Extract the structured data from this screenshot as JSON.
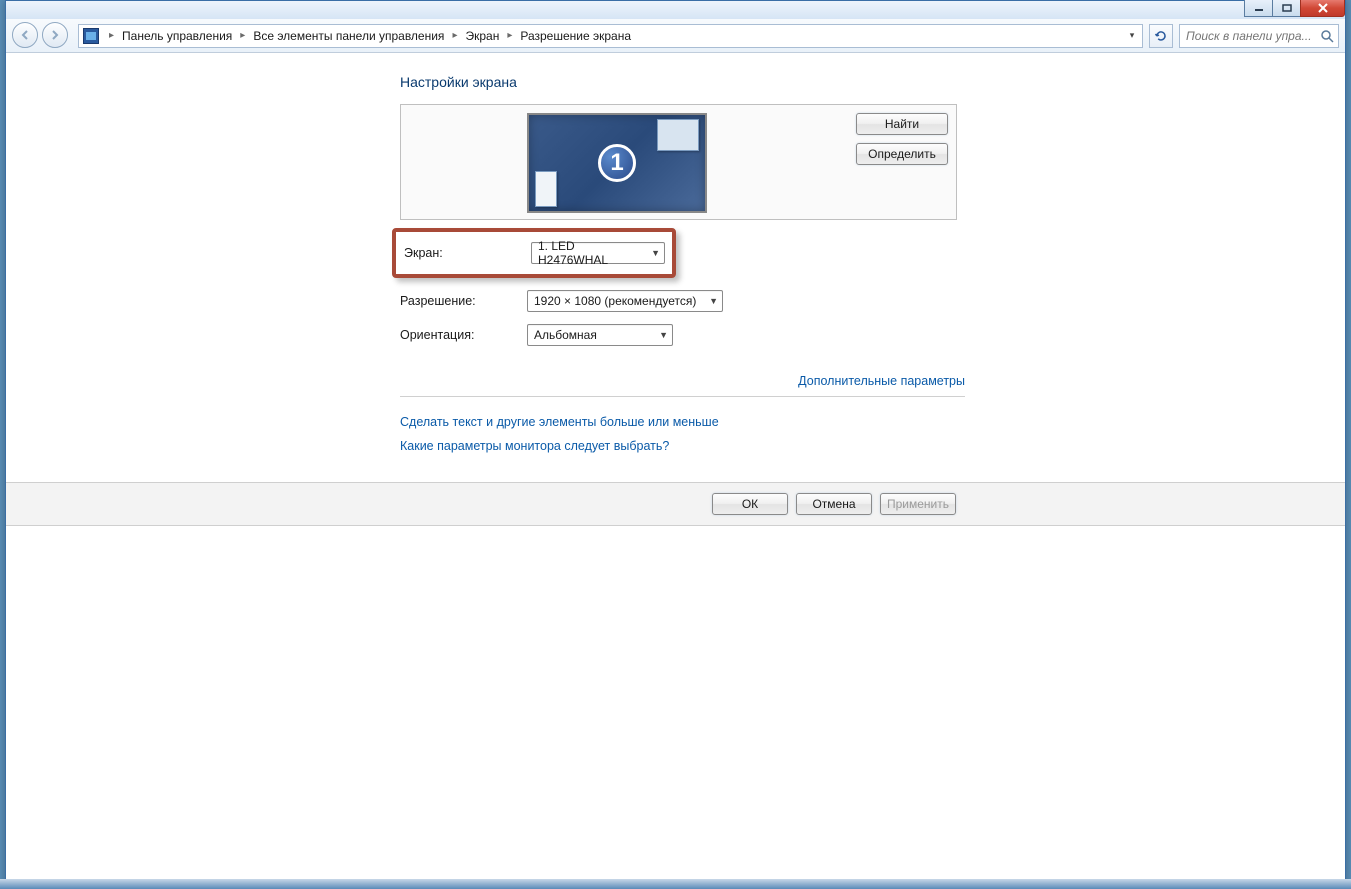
{
  "breadcrumb": {
    "items": [
      "Панель управления",
      "Все элементы панели управления",
      "Экран",
      "Разрешение экрана"
    ]
  },
  "search": {
    "placeholder": "Поиск в панели упра..."
  },
  "page": {
    "title": "Настройки экрана"
  },
  "preview": {
    "monitor_number": "1",
    "btn_find": "Найти",
    "btn_identify": "Определить"
  },
  "form": {
    "screen_label": "Экран:",
    "screen_value": "1. LED H2476WHAL",
    "resolution_label": "Разрешение:",
    "resolution_value": "1920 × 1080 (рекомендуется)",
    "orientation_label": "Ориентация:",
    "orientation_value": "Альбомная"
  },
  "links": {
    "advanced": "Дополнительные параметры",
    "text_size": "Сделать текст и другие элементы больше или меньше",
    "which_monitor": "Какие параметры монитора следует выбрать?"
  },
  "footer": {
    "ok": "ОК",
    "cancel": "Отмена",
    "apply": "Применить"
  }
}
